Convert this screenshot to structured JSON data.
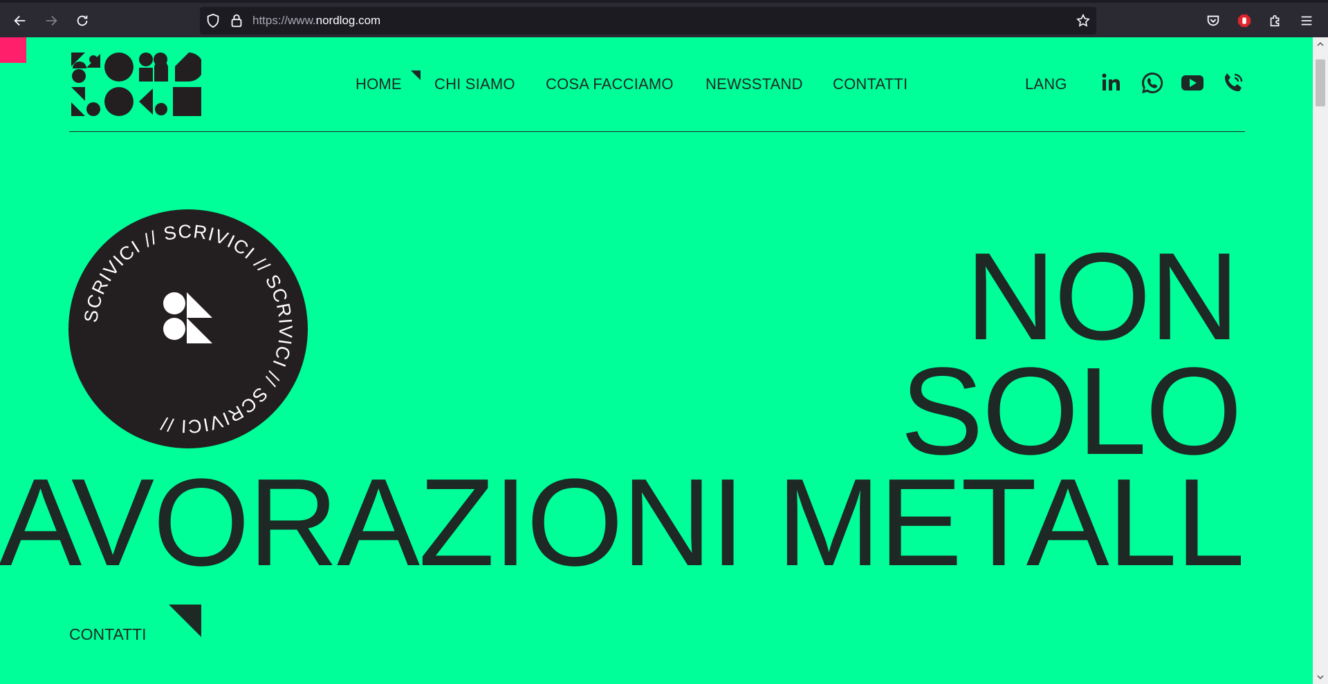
{
  "browser": {
    "url_prefix": "https://www.",
    "url_domain": "nordlog.com",
    "url_suffix": ".com"
  },
  "nav": {
    "items": [
      {
        "label": "HOME",
        "active": true
      },
      {
        "label": "CHI SIAMO"
      },
      {
        "label": "COSA FACCIAMO"
      },
      {
        "label": "NEWSSTAND"
      },
      {
        "label": "CONTATTI"
      }
    ],
    "lang": "LANG"
  },
  "social_icons": [
    "linkedin-icon",
    "whatsapp-icon",
    "youtube-icon",
    "phone-icon"
  ],
  "badge": {
    "ring_text": "SCRIVICI // SCRIVICI // SCRIVICI // SCRIVICI // "
  },
  "hero": {
    "line1": "NON",
    "line2": "SOLO",
    "line3": "AVORAZIONI METALL"
  },
  "cta": {
    "label": "CONTATTI"
  },
  "colors": {
    "page_background": "#00ff99",
    "text": "#1e2824",
    "corner_accent": "#ff1f6b",
    "badge": "#231f20"
  }
}
